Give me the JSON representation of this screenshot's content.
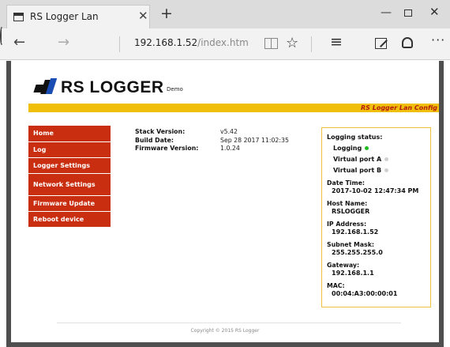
{
  "browser": {
    "tab_title": "RS Logger Lan",
    "url_host": "192.168.1.52",
    "url_path": "/index.htm",
    "icons": {
      "tab": "page-icon",
      "close_tab": "close-icon",
      "new_tab": "plus-icon",
      "back": "back-arrow-icon",
      "forward": "forward-arrow-icon",
      "refresh": "refresh-icon",
      "reading_view": "reading-view-icon",
      "favorite": "star-icon",
      "hub": "hub-icon",
      "web_note": "web-note-icon",
      "share": "share-icon",
      "more": "more-icon"
    }
  },
  "logo": {
    "text": "RS LOGGER",
    "suffix": "Demo"
  },
  "config_bar": {
    "label": "RS Logger Lan Config",
    "bar_color": "#f0bf0a",
    "text_color": "#b51d0d"
  },
  "menu": {
    "color": "#c92e10",
    "items": [
      {
        "label": "Home"
      },
      {
        "label": "Log"
      },
      {
        "label": "Logger Settings"
      },
      {
        "label": "Network Settings"
      },
      {
        "label": "Firmware Update"
      },
      {
        "label": "Reboot device"
      }
    ]
  },
  "info": {
    "stack_version_label": "Stack Version:",
    "stack_version_value": "v5.42",
    "build_date_label": "Build Date:",
    "build_date_value": "Sep 28 2017 11:02:35",
    "firmware_version_label": "Firmware Version:",
    "firmware_version_value": "1.0.24"
  },
  "status": {
    "title": "Logging status:",
    "logging_label": "Logging",
    "logging_color": "#22bb22",
    "virtual_a_label": "Virtual port A",
    "virtual_b_label": "Virtual port B",
    "inactive_color": "#d0d0d0",
    "datetime_label": "Date Time:",
    "datetime_value": "2017-10-02 12:47:34 PM",
    "hostname_label": "Host Name:",
    "hostname_value": "RSLOGGER",
    "ip_label": "IP Address:",
    "ip_value": "192.168.1.52",
    "subnet_label": "Subnet Mask:",
    "subnet_value": "255.255.255.0",
    "gateway_label": "Gateway:",
    "gateway_value": "192.168.1.1",
    "mac_label": "MAC:",
    "mac_value": "00:04:A3:00:00:01"
  },
  "footer": {
    "copyright": "Copyright © 2015 RS Logger"
  }
}
